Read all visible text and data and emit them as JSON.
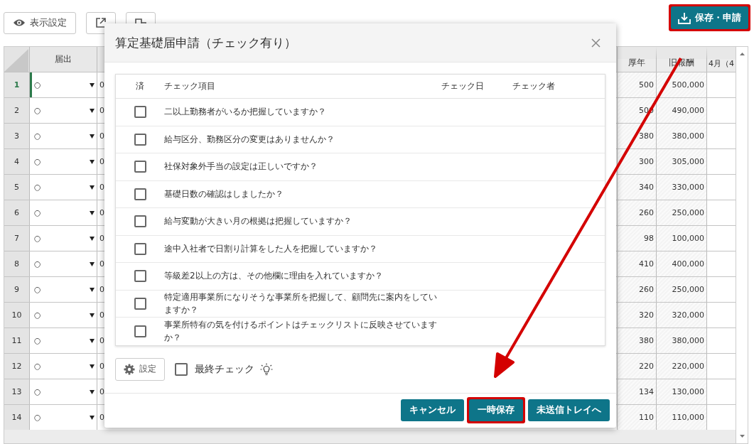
{
  "toolbar": {
    "buttons": [
      {
        "kind": "eye",
        "label": "表示設定"
      },
      {
        "kind": "external"
      },
      {
        "kind": "office"
      }
    ],
    "primary": {
      "label": "保存・申請",
      "highlighted": true
    }
  },
  "table": {
    "columns": [
      {
        "kind": "todokede",
        "label": "届出"
      },
      {
        "kind": "kounen",
        "label": "厚年"
      },
      {
        "kind": "pay",
        "label": "旧報酬"
      },
      {
        "kind": "month",
        "label": "4月（4"
      }
    ],
    "rows": [
      {
        "number": "1",
        "selected": true,
        "todokede": "○",
        "column_3": "0",
        "kounen": "500",
        "old_pay": "500,000"
      },
      {
        "number": "2",
        "selected": false,
        "todokede": "○",
        "column_3": "0",
        "kounen": "500",
        "old_pay": "490,000"
      },
      {
        "number": "3",
        "selected": false,
        "todokede": "○",
        "column_3": "0",
        "kounen": "380",
        "old_pay": "380,000"
      },
      {
        "number": "4",
        "selected": false,
        "todokede": "○",
        "column_3": "0",
        "kounen": "300",
        "old_pay": "305,000"
      },
      {
        "number": "5",
        "selected": false,
        "todokede": "○",
        "column_3": "0",
        "kounen": "340",
        "old_pay": "330,000"
      },
      {
        "number": "6",
        "selected": false,
        "todokede": "○",
        "column_3": "0",
        "kounen": "260",
        "old_pay": "250,000"
      },
      {
        "number": "7",
        "selected": false,
        "todokede": "○",
        "column_3": "0",
        "kounen": "98",
        "old_pay": "100,000"
      },
      {
        "number": "8",
        "selected": false,
        "todokede": "○",
        "column_3": "0",
        "kounen": "410",
        "old_pay": "400,000"
      },
      {
        "number": "9",
        "selected": false,
        "todokede": "○",
        "column_3": "0",
        "kounen": "260",
        "old_pay": "250,000"
      },
      {
        "number": "10",
        "selected": false,
        "todokede": "○",
        "column_3": "0",
        "kounen": "320",
        "old_pay": "320,000"
      },
      {
        "number": "11",
        "selected": false,
        "todokede": "○",
        "column_3": "0",
        "kounen": "380",
        "old_pay": "380,000"
      },
      {
        "number": "12",
        "selected": false,
        "todokede": "○",
        "column_3": "0",
        "kounen": "220",
        "old_pay": "220,000"
      },
      {
        "number": "13",
        "selected": false,
        "todokede": "○",
        "column_3": "0",
        "kounen": "134",
        "old_pay": "130,000"
      },
      {
        "number": "14",
        "selected": false,
        "todokede": "○",
        "column_3": "0",
        "kounen": "110",
        "old_pay": "110,000"
      }
    ]
  },
  "dialog": {
    "title": "算定基礎届申請（チェック有り）",
    "columns": [
      "済",
      "チェック項目",
      "チェック日",
      "チェック者"
    ],
    "items": [
      {
        "text": "二以上勤務者がいるか把握していますか？",
        "checked": false
      },
      {
        "text": "給与区分、勤務区分の変更はありませんか？",
        "checked": false
      },
      {
        "text": "社保対象外手当の設定は正しいですか？",
        "checked": false
      },
      {
        "text": "基礎日数の確認はしましたか？",
        "checked": false
      },
      {
        "text": "給与変動が大きい月の根拠は把握していますか？",
        "checked": false
      },
      {
        "text": "途中入社者で日割り計算をした人を把握していますか？",
        "checked": false
      },
      {
        "text": "等級差2以上の方は、その他欄に理由を入れていますか？",
        "checked": false
      },
      {
        "text": "特定適用事業所になりそうな事業所を把握して、顧問先に案内をしていますか？",
        "checked": false
      },
      {
        "text": "事業所特有の気を付けるポイントはチェックリストに反映させていますか？",
        "checked": false
      }
    ],
    "settings_button": "設定",
    "final_check": {
      "label": "最終チェック",
      "checked": false
    },
    "buttons": [
      {
        "label": "キャンセル",
        "highlighted": false
      },
      {
        "label": "一時保存",
        "highlighted": true
      },
      {
        "label": "未送信トレイへ",
        "highlighted": false
      }
    ]
  }
}
